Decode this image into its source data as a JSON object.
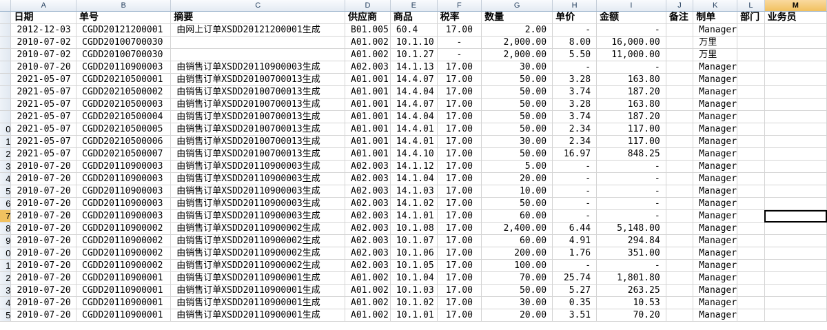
{
  "columns": [
    "A",
    "B",
    "C",
    "D",
    "E",
    "F",
    "G",
    "H",
    "I",
    "J",
    "K",
    "L",
    "M"
  ],
  "selected_column": "M",
  "row_numbers": [
    "",
    "",
    "",
    "",
    "",
    "",
    "",
    "",
    "",
    "0",
    "1",
    "2",
    "3",
    "4",
    "5",
    "6",
    "7",
    "8",
    "9",
    "0",
    "1",
    "2",
    "3",
    "4",
    "5"
  ],
  "headers": [
    "日期",
    "单号",
    "摘要",
    "供应商",
    "商品",
    "税率",
    "数量",
    "单价",
    "金额",
    "备注",
    "制单",
    "部门",
    "业务员"
  ],
  "rows": [
    [
      "2012-12-03",
      "CGDD20121200001",
      "由网上订单XSDD20121200001生成",
      "B01.005",
      "60.4",
      "17.00",
      "2.00",
      "-",
      "-",
      "",
      "Manager",
      "",
      ""
    ],
    [
      "2010-07-02",
      "CGDD20100700030",
      "",
      "A01.002",
      "10.1.10",
      "-",
      "2,000.00",
      "8.00",
      "16,000.00",
      "",
      "万里",
      "",
      ""
    ],
    [
      "2010-07-02",
      "CGDD20100700030",
      "",
      "A01.002",
      "10.1.27",
      "-",
      "2,000.00",
      "5.50",
      "11,000.00",
      "",
      "万里",
      "",
      ""
    ],
    [
      "2010-07-20",
      "CGDD20110900003",
      "由销售订单XSDD20110900003生成",
      "A02.003",
      "14.1.13",
      "17.00",
      "30.00",
      "-",
      "-",
      "",
      "Manager",
      "",
      ""
    ],
    [
      "2021-05-07",
      "CGDD20210500001",
      "由销售订单XSDD20100700013生成",
      "A01.001",
      "14.4.07",
      "17.00",
      "50.00",
      "3.28",
      "163.80",
      "",
      "Manager",
      "",
      ""
    ],
    [
      "2021-05-07",
      "CGDD20210500002",
      "由销售订单XSDD20100700013生成",
      "A01.001",
      "14.4.04",
      "17.00",
      "50.00",
      "3.74",
      "187.20",
      "",
      "Manager",
      "",
      ""
    ],
    [
      "2021-05-07",
      "CGDD20210500003",
      "由销售订单XSDD20100700013生成",
      "A01.001",
      "14.4.07",
      "17.00",
      "50.00",
      "3.28",
      "163.80",
      "",
      "Manager",
      "",
      ""
    ],
    [
      "2021-05-07",
      "CGDD20210500004",
      "由销售订单XSDD20100700013生成",
      "A01.001",
      "14.4.04",
      "17.00",
      "50.00",
      "3.74",
      "187.20",
      "",
      "Manager",
      "",
      ""
    ],
    [
      "2021-05-07",
      "CGDD20210500005",
      "由销售订单XSDD20100700013生成",
      "A01.001",
      "14.4.01",
      "17.00",
      "50.00",
      "2.34",
      "117.00",
      "",
      "Manager",
      "",
      ""
    ],
    [
      "2021-05-07",
      "CGDD20210500006",
      "由销售订单XSDD20100700013生成",
      "A01.001",
      "14.4.01",
      "17.00",
      "30.00",
      "2.34",
      "117.00",
      "",
      "Manager",
      "",
      ""
    ],
    [
      "2021-05-07",
      "CGDD20210500007",
      "由销售订单XSDD20100700013生成",
      "A01.001",
      "14.4.10",
      "17.00",
      "50.00",
      "16.97",
      "848.25",
      "",
      "Manager",
      "",
      ""
    ],
    [
      "2010-07-20",
      "CGDD20110900003",
      "由销售订单XSDD20110900003生成",
      "A02.003",
      "14.1.12",
      "17.00",
      "5.00",
      "-",
      "-",
      "",
      "Manager",
      "",
      ""
    ],
    [
      "2010-07-20",
      "CGDD20110900003",
      "由销售订单XSDD20110900003生成",
      "A02.003",
      "14.1.04",
      "17.00",
      "20.00",
      "-",
      "-",
      "",
      "Manager",
      "",
      ""
    ],
    [
      "2010-07-20",
      "CGDD20110900003",
      "由销售订单XSDD20110900003生成",
      "A02.003",
      "14.1.03",
      "17.00",
      "10.00",
      "-",
      "-",
      "",
      "Manager",
      "",
      ""
    ],
    [
      "2010-07-20",
      "CGDD20110900003",
      "由销售订单XSDD20110900003生成",
      "A02.003",
      "14.1.02",
      "17.00",
      "50.00",
      "-",
      "-",
      "",
      "Manager",
      "",
      ""
    ],
    [
      "2010-07-20",
      "CGDD20110900003",
      "由销售订单XSDD20110900003生成",
      "A02.003",
      "14.1.01",
      "17.00",
      "60.00",
      "-",
      "-",
      "",
      "Manager",
      "",
      ""
    ],
    [
      "2010-07-20",
      "CGDD20110900002",
      "由销售订单XSDD20110900002生成",
      "A02.003",
      "10.1.08",
      "17.00",
      "2,400.00",
      "6.44",
      "5,148.00",
      "",
      "Manager",
      "",
      ""
    ],
    [
      "2010-07-20",
      "CGDD20110900002",
      "由销售订单XSDD20110900002生成",
      "A02.003",
      "10.1.07",
      "17.00",
      "60.00",
      "4.91",
      "294.84",
      "",
      "Manager",
      "",
      ""
    ],
    [
      "2010-07-20",
      "CGDD20110900002",
      "由销售订单XSDD20110900002生成",
      "A02.003",
      "10.1.06",
      "17.00",
      "200.00",
      "1.76",
      "351.00",
      "",
      "Manager",
      "",
      ""
    ],
    [
      "2010-07-20",
      "CGDD20110900002",
      "由销售订单XSDD20110900002生成",
      "A02.003",
      "10.1.05",
      "17.00",
      "100.00",
      "-",
      "-",
      "",
      "Manager",
      "",
      ""
    ],
    [
      "2010-07-20",
      "CGDD20110900001",
      "由销售订单XSDD20110900001生成",
      "A01.002",
      "10.1.04",
      "17.00",
      "70.00",
      "25.74",
      "1,801.80",
      "",
      "Manager",
      "",
      ""
    ],
    [
      "2010-07-20",
      "CGDD20110900001",
      "由销售订单XSDD20110900001生成",
      "A01.002",
      "10.1.03",
      "17.00",
      "50.00",
      "5.27",
      "263.25",
      "",
      "Manager",
      "",
      ""
    ],
    [
      "2010-07-20",
      "CGDD20110900001",
      "由销售订单XSDD20110900001生成",
      "A01.002",
      "10.1.02",
      "17.00",
      "30.00",
      "0.35",
      "10.53",
      "",
      "Manager",
      "",
      ""
    ],
    [
      "2010-07-20",
      "CGDD20110900001",
      "由销售订单XSDD20110900001生成",
      "A01.002",
      "10.1.01",
      "17.00",
      "20.00",
      "3.51",
      "70.20",
      "",
      "Manager",
      "",
      ""
    ]
  ]
}
